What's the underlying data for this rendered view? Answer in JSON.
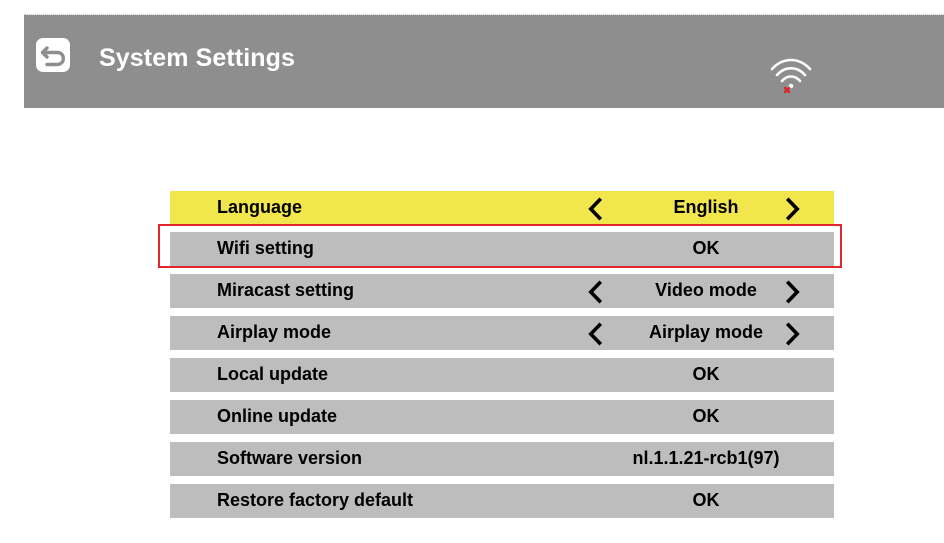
{
  "header": {
    "title": "System Settings"
  },
  "settings": {
    "rows": [
      {
        "label": "Language",
        "value": "English",
        "left_arrow": "‹",
        "right_arrow": "›"
      },
      {
        "label": "Wifi setting",
        "value": "OK"
      },
      {
        "label": "Miracast setting",
        "value": "Video mode",
        "left_arrow": "‹",
        "right_arrow": "›"
      },
      {
        "label": "Airplay mode",
        "value": "Airplay mode",
        "left_arrow": "‹",
        "right_arrow": "›"
      },
      {
        "label": "Local update",
        "value": "OK"
      },
      {
        "label": "Online update",
        "value": "OK"
      },
      {
        "label": "Software version",
        "value": "nl.1.1.21-rcb1(97)"
      },
      {
        "label": "Restore factory default",
        "value": "OK"
      }
    ]
  },
  "colors": {
    "header_background": "#8e8e8e",
    "row_background": "#bdbdbd",
    "active_row_background": "#f2e64d",
    "focus_outline": "#e3262d",
    "text": "#000000",
    "header_text": "#ffffff"
  },
  "icons": {
    "back": "back-arrow-icon",
    "wifi": "wifi-disconnected-icon",
    "previous": "chevron-left-icon",
    "next": "chevron-right-icon"
  }
}
